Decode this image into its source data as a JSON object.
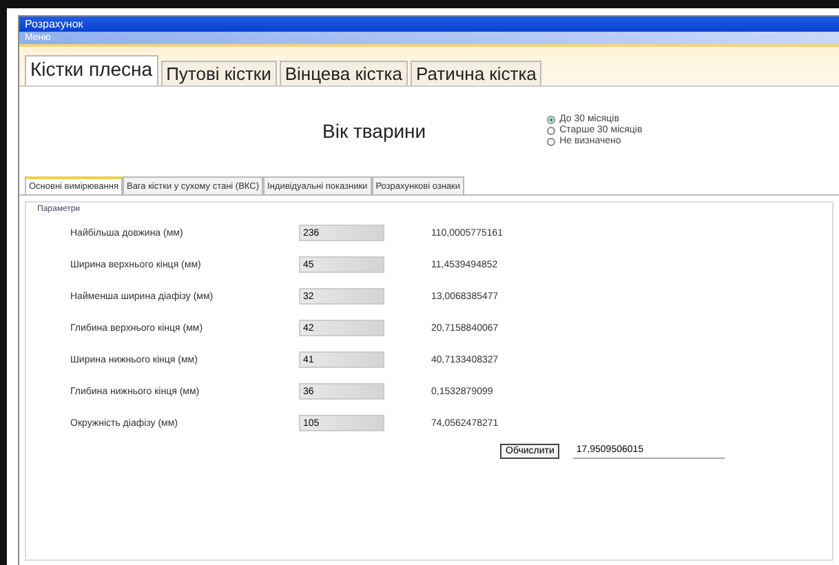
{
  "window": {
    "title": "Розрахунок"
  },
  "menu": [
    "Меню"
  ],
  "tabs": [
    {
      "label": "Кістки плесна",
      "selected": true
    },
    {
      "label": "Путові кістки",
      "selected": false
    },
    {
      "label": "Вінцева кістка",
      "selected": false
    },
    {
      "label": "Ратична кістка",
      "selected": false
    }
  ],
  "age": {
    "heading": "Вік тварини",
    "options": [
      {
        "label": "До 30 місяців",
        "selected": true
      },
      {
        "label": "Старше 30 місяців",
        "selected": false
      },
      {
        "label": "Не визначено",
        "selected": false
      }
    ]
  },
  "subtabs": [
    {
      "label": "Основні вимірювання",
      "selected": true
    },
    {
      "label": "Вага кістки у сухому стані (ВКС)",
      "selected": false
    },
    {
      "label": "Індивідуальні показники",
      "selected": false
    },
    {
      "label": "Розрахункові ознаки",
      "selected": false
    }
  ],
  "group": {
    "title": "Параметри"
  },
  "rows": [
    {
      "label": "Найбільша довжина (мм)",
      "value": "236",
      "result": "110,0005775161"
    },
    {
      "label": "Ширина верхнього кінця (мм)",
      "value": "45",
      "result": "11,4539494852"
    },
    {
      "label": "Найменша ширина діафізу (мм)",
      "value": "32",
      "result": "13,0068385477"
    },
    {
      "label": "Глибина верхнього кінця (мм)",
      "value": "42",
      "result": "20,7158840067"
    },
    {
      "label": "Ширина нижнього кінця (мм)",
      "value": "41",
      "result": "40,7133408327"
    },
    {
      "label": "Глибина нижнього кінця (мм)",
      "value": "36",
      "result": "0,1532879099"
    },
    {
      "label": "Окружність діафізу (мм)",
      "value": "105",
      "result": "74,0562478271"
    }
  ],
  "calculate": {
    "label": "Обчислити",
    "result": "17,9509506015"
  }
}
